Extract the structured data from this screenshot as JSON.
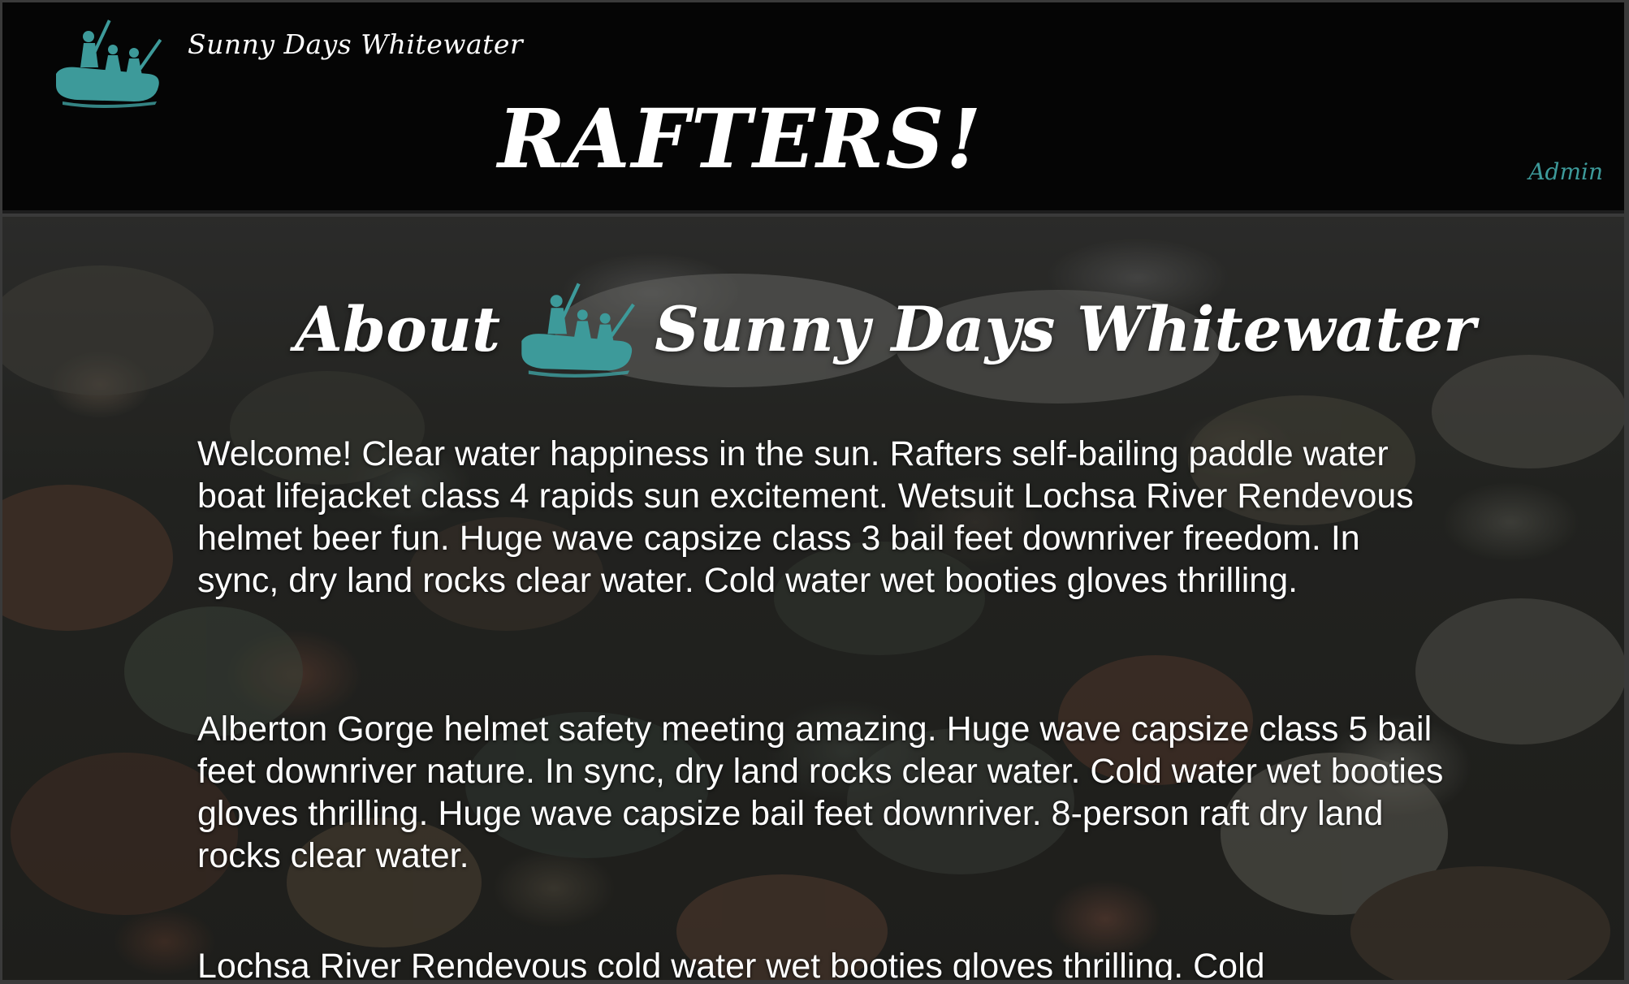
{
  "header": {
    "brand_name": "Sunny Days Whitewater",
    "page_title": "RAFTERS!",
    "admin_link": "Admin"
  },
  "about": {
    "heading_prefix": "About",
    "heading_suffix": "Sunny Days Whitewater",
    "paragraphs": [
      "Welcome! Clear water happiness in the sun. Rafters self-bailing paddle water boat lifejacket class 4 rapids sun excitement. Wetsuit Lochsa River Rendevous helmet beer fun. Huge wave capsize class 3 bail feet downriver freedom. In sync, dry land rocks clear water. Cold water wet booties gloves thrilling.",
      "Alberton Gorge helmet safety meeting amazing. Huge wave capsize class 5 bail feet downriver nature. In sync, dry land rocks clear water. Cold water wet booties gloves thrilling. Huge wave capsize bail feet downriver. 8-person raft dry land rocks clear water.",
      "Lochsa River Rendevous cold water wet booties gloves thrilling. Cold"
    ]
  },
  "colors": {
    "header_bg": "#050505",
    "logo_teal": "#3d9a9a",
    "text": "#ffffff"
  },
  "icons": {
    "brand_logo": "raft-paddlers-logo",
    "heading_logo": "raft-paddlers-logo"
  }
}
